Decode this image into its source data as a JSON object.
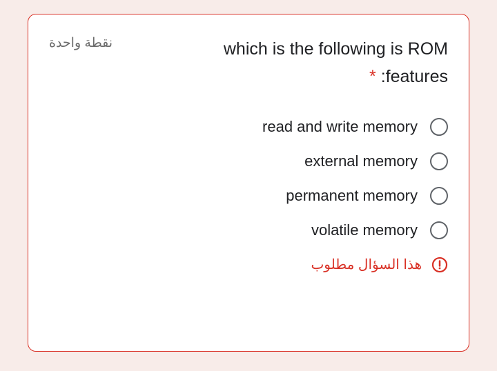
{
  "points": "نقطة واحدة",
  "question": "which is the following is ROM :features",
  "required_marker": "*",
  "options": [
    "read and write memory",
    "external memory",
    "permanent memory",
    "volatile memory"
  ],
  "error": "هذا السؤال مطلوب"
}
